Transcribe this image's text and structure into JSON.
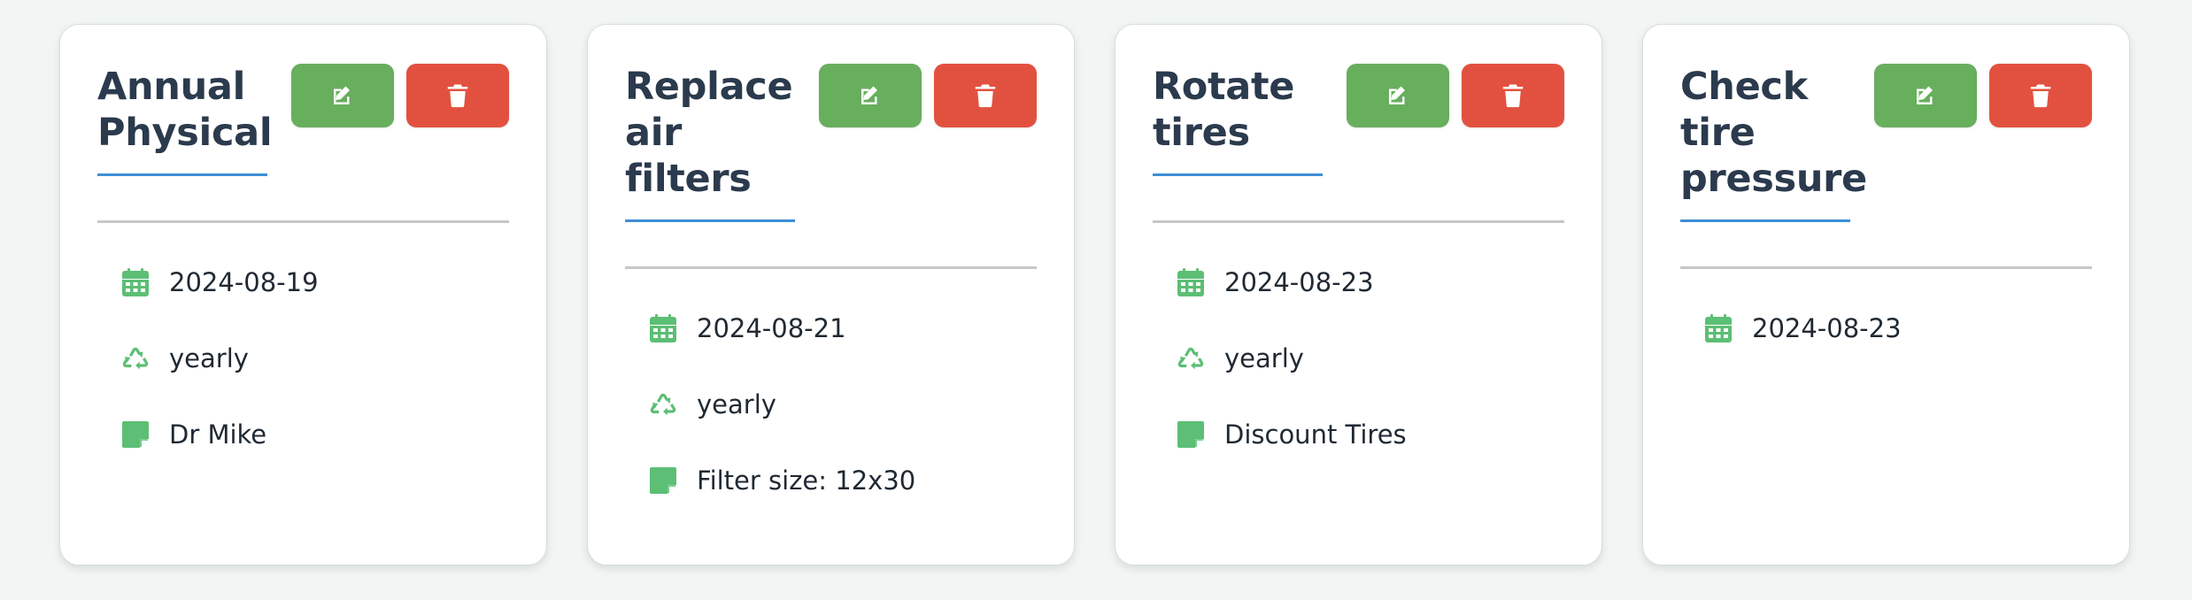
{
  "colors": {
    "background": "#f1f6f4",
    "edit_button": "#67ae5d",
    "delete_button": "#e2513f",
    "icon_green": "#5dbe75",
    "title_underline": "#3d8fd6",
    "title_text": "#2b3a4d"
  },
  "icons": {
    "edit": "pencil-square-icon",
    "delete": "trash-icon",
    "date": "calendar-icon",
    "frequency": "recycle-icon",
    "note": "sticky-note-icon"
  },
  "cards": [
    {
      "title_lines": [
        "Annual",
        "Physical"
      ],
      "date": "2024-08-19",
      "frequency": "yearly",
      "note": "Dr Mike"
    },
    {
      "title_lines": [
        "Replace",
        "air",
        "filters"
      ],
      "date": "2024-08-21",
      "frequency": "yearly",
      "note": "Filter size: 12x30"
    },
    {
      "title_lines": [
        "Rotate",
        "tires"
      ],
      "date": "2024-08-23",
      "frequency": "yearly",
      "note": "Discount Tires"
    },
    {
      "title_lines": [
        "Check",
        "tire",
        "pressure"
      ],
      "date": "2024-08-23"
    }
  ]
}
